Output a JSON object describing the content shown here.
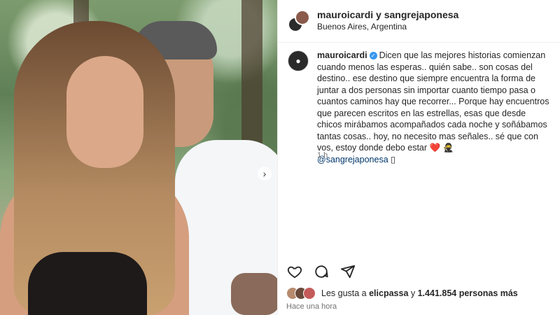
{
  "post": {
    "owner_line": "mauroicardi y sangrejaponesa",
    "location": "Buenos Aires, Argentina"
  },
  "caption": {
    "username": "mauroicardi",
    "text": "Dicen que las mejores historias comienzan cuando menos las esperas.. quién sabe.. son cosas del destino.. ese destino que siempre encuentra la forma de juntar a dos personas sin importar cuanto tiempo pasa o cuantos caminos hay que recorrer... Porque hay encuentros que parecen escritos en las estrellas, esas que desde chicos mirábamos acompañados cada noche y soñábamos tantas cosas.. hoy, no necesito mas señales.. sé que con vos, estoy donde debo estar ",
    "emoji": "❤️ 🥷",
    "mention": "@sangrejaponesa",
    "trailing_glyph": "▯",
    "time": "1 h"
  },
  "likes": {
    "prefix": "Les gusta a ",
    "user": "elicpassa",
    "middle": " y ",
    "count": "1.441.854 personas más"
  },
  "posted_relative": "Hace una hora",
  "icons": {
    "like": "heart-outline-icon",
    "comment": "comment-bubble-icon",
    "share": "paper-plane-icon",
    "next": "chevron-right-icon",
    "verified": "verified-badge-icon"
  },
  "colors": {
    "verified": "#3897f0",
    "mention": "#00376b",
    "muted": "#737373",
    "heart": "#d92c2c"
  }
}
